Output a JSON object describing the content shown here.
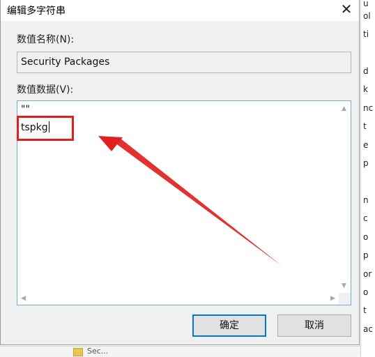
{
  "background": {
    "right_fragments": [
      "u",
      "ol",
      "ti",
      "d",
      "k",
      "nc",
      "t",
      "e",
      "p",
      "n",
      "c",
      "o",
      "p",
      "or",
      "o",
      "t",
      "ac"
    ],
    "bottom_text": "Sec..."
  },
  "dialog": {
    "title": "编辑多字符串",
    "close_glyph": "✕",
    "name_label": "数值名称(N):",
    "name_value": "Security Packages",
    "data_label": "数值数据(V):",
    "data_lines": [
      "\"\"",
      "tspkg"
    ],
    "ok_label": "确定",
    "cancel_label": "取消"
  },
  "colors": {
    "annotation_red": "#e02020",
    "focus_blue": "#0078d7",
    "dialog_bg": "#f0f0f0"
  }
}
